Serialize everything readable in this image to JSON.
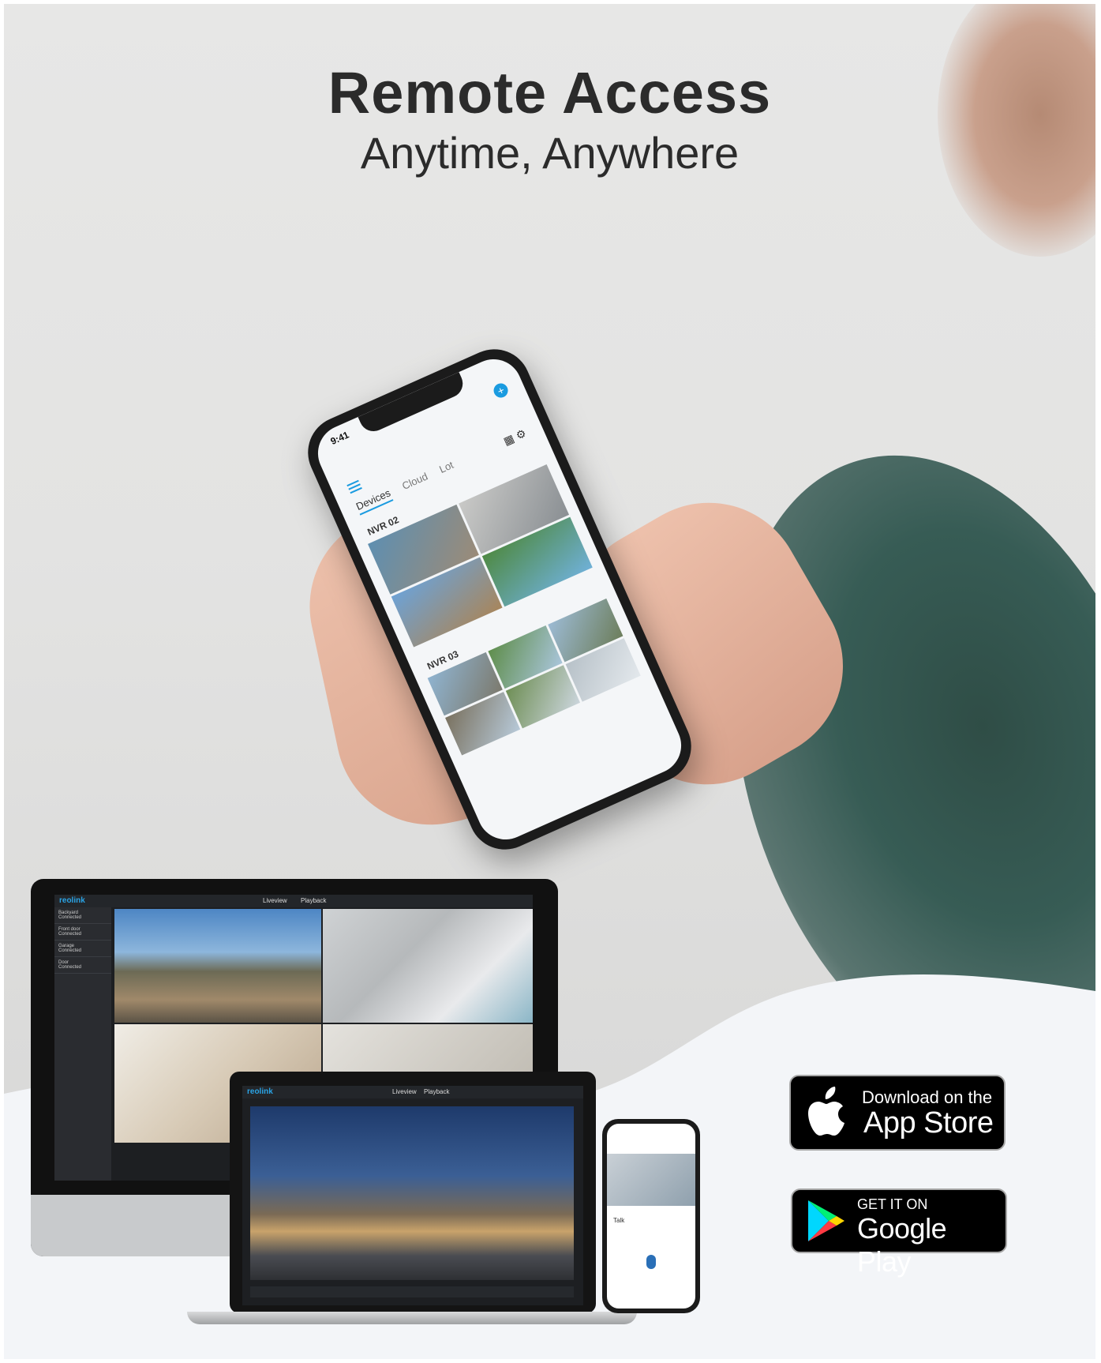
{
  "headline": {
    "title": "Remote Access",
    "subtitle": "Anytime, Anywhere"
  },
  "phone_app": {
    "time": "9:41",
    "tabs": [
      "Devices",
      "Cloud",
      "Lot"
    ],
    "groups": [
      "NVR 02",
      "NVR 03"
    ]
  },
  "desktop_app": {
    "logo": "reolink",
    "tabs": [
      "Liveview",
      "Playback"
    ],
    "cameras": [
      "Backyard",
      "Front door",
      "Garage",
      "Door"
    ],
    "camera_status": "Connected"
  },
  "laptop_app": {
    "logo": "reolink",
    "tabs": [
      "Liveview",
      "Playback"
    ]
  },
  "small_phone": {
    "talk_label": "Talk"
  },
  "badges": {
    "app_store": {
      "small": "Download on the",
      "big": "App Store"
    },
    "google_play": {
      "small": "GET IT ON",
      "big": "Google Play"
    }
  },
  "colors": {
    "accent": "#1a9be0",
    "text_dark": "#2b2b2b",
    "badge_bg": "#000000"
  }
}
